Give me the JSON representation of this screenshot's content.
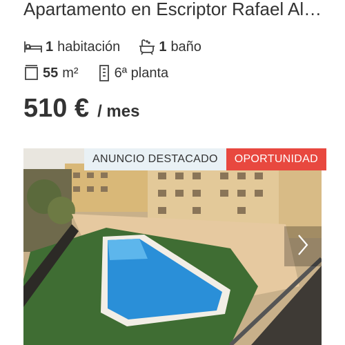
{
  "listing": {
    "title": "Apartamento en Escriptor Rafael Alberti",
    "features": {
      "rooms": {
        "icon": "bed-icon",
        "value": "1",
        "label": "habitación"
      },
      "baths": {
        "icon": "bathtub-icon",
        "value": "1",
        "label": "baño"
      },
      "area": {
        "icon": "area-icon",
        "value": "55",
        "label": "m²"
      },
      "floor": {
        "icon": "building-icon",
        "label": "6ª planta"
      }
    },
    "price": {
      "amount": "510 €",
      "period": "/ mes"
    },
    "gallery": {
      "badges": {
        "featured": "ANUNCIO DESTACADO",
        "opportunity": "OPORTUNIDAD"
      },
      "next_icon": "chevron-right-icon"
    }
  },
  "colors": {
    "opportunity": "#e8483f",
    "featured_bg": "#e9f1f5",
    "text": "#333333"
  }
}
